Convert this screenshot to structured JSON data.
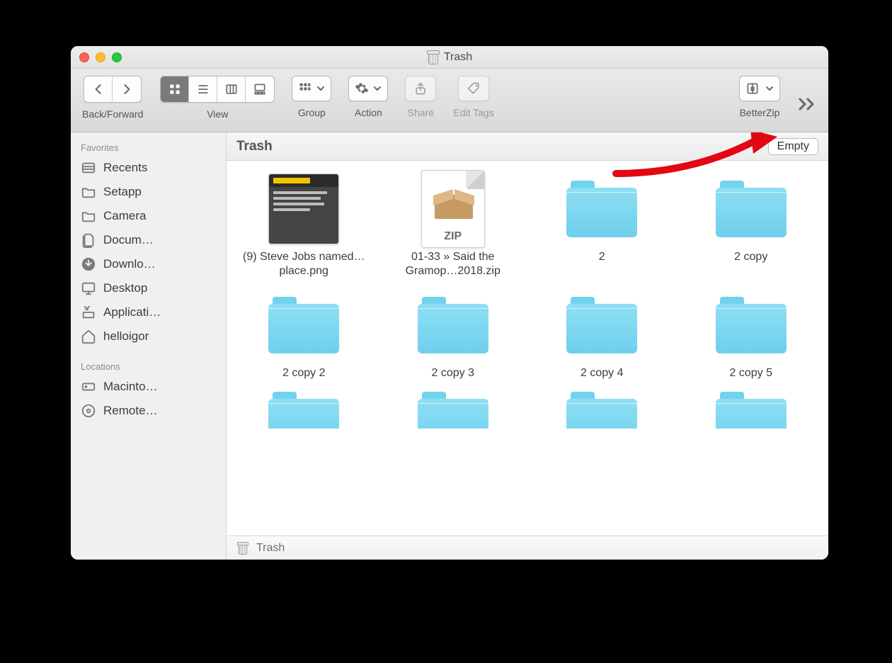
{
  "window_title": "Trash",
  "toolbar": {
    "back_forward_label": "Back/Forward",
    "view_label": "View",
    "group_label": "Group",
    "action_label": "Action",
    "share_label": "Share",
    "edit_tags_label": "Edit Tags",
    "betterzip_label": "BetterZip"
  },
  "sidebar": {
    "favorites_header": "Favorites",
    "locations_header": "Locations",
    "favorites": [
      {
        "label": "Recents",
        "icon": "recents-icon"
      },
      {
        "label": "Setapp",
        "icon": "folder-icon"
      },
      {
        "label": "Camera",
        "icon": "folder-icon"
      },
      {
        "label": "Docum…",
        "icon": "documents-icon"
      },
      {
        "label": "Downlo…",
        "icon": "downloads-icon"
      },
      {
        "label": "Desktop",
        "icon": "desktop-icon"
      },
      {
        "label": "Applicati…",
        "icon": "applications-icon"
      },
      {
        "label": "helloigor",
        "icon": "home-icon"
      }
    ],
    "locations": [
      {
        "label": "Macinto…",
        "icon": "hard-drive-icon"
      },
      {
        "label": "Remote…",
        "icon": "remote-disc-icon"
      }
    ]
  },
  "location_bar": {
    "title": "Trash",
    "empty_button": "Empty"
  },
  "files": {
    "row1": [
      {
        "name": "(9) Steve Jobs named…place.png",
        "kind": "image"
      },
      {
        "name": "01-33 » Said the Gramop…2018.zip",
        "kind": "zip"
      },
      {
        "name": "2",
        "kind": "folder"
      },
      {
        "name": "2 copy",
        "kind": "folder"
      }
    ],
    "row2": [
      {
        "name": "2 copy 2",
        "kind": "folder"
      },
      {
        "name": "2 copy 3",
        "kind": "folder"
      },
      {
        "name": "2 copy 4",
        "kind": "folder"
      },
      {
        "name": "2 copy 5",
        "kind": "folder"
      }
    ],
    "row3": [
      {
        "name": "",
        "kind": "folder"
      },
      {
        "name": "",
        "kind": "folder"
      },
      {
        "name": "",
        "kind": "folder"
      },
      {
        "name": "",
        "kind": "folder"
      }
    ]
  },
  "pathbar": {
    "label": "Trash"
  }
}
